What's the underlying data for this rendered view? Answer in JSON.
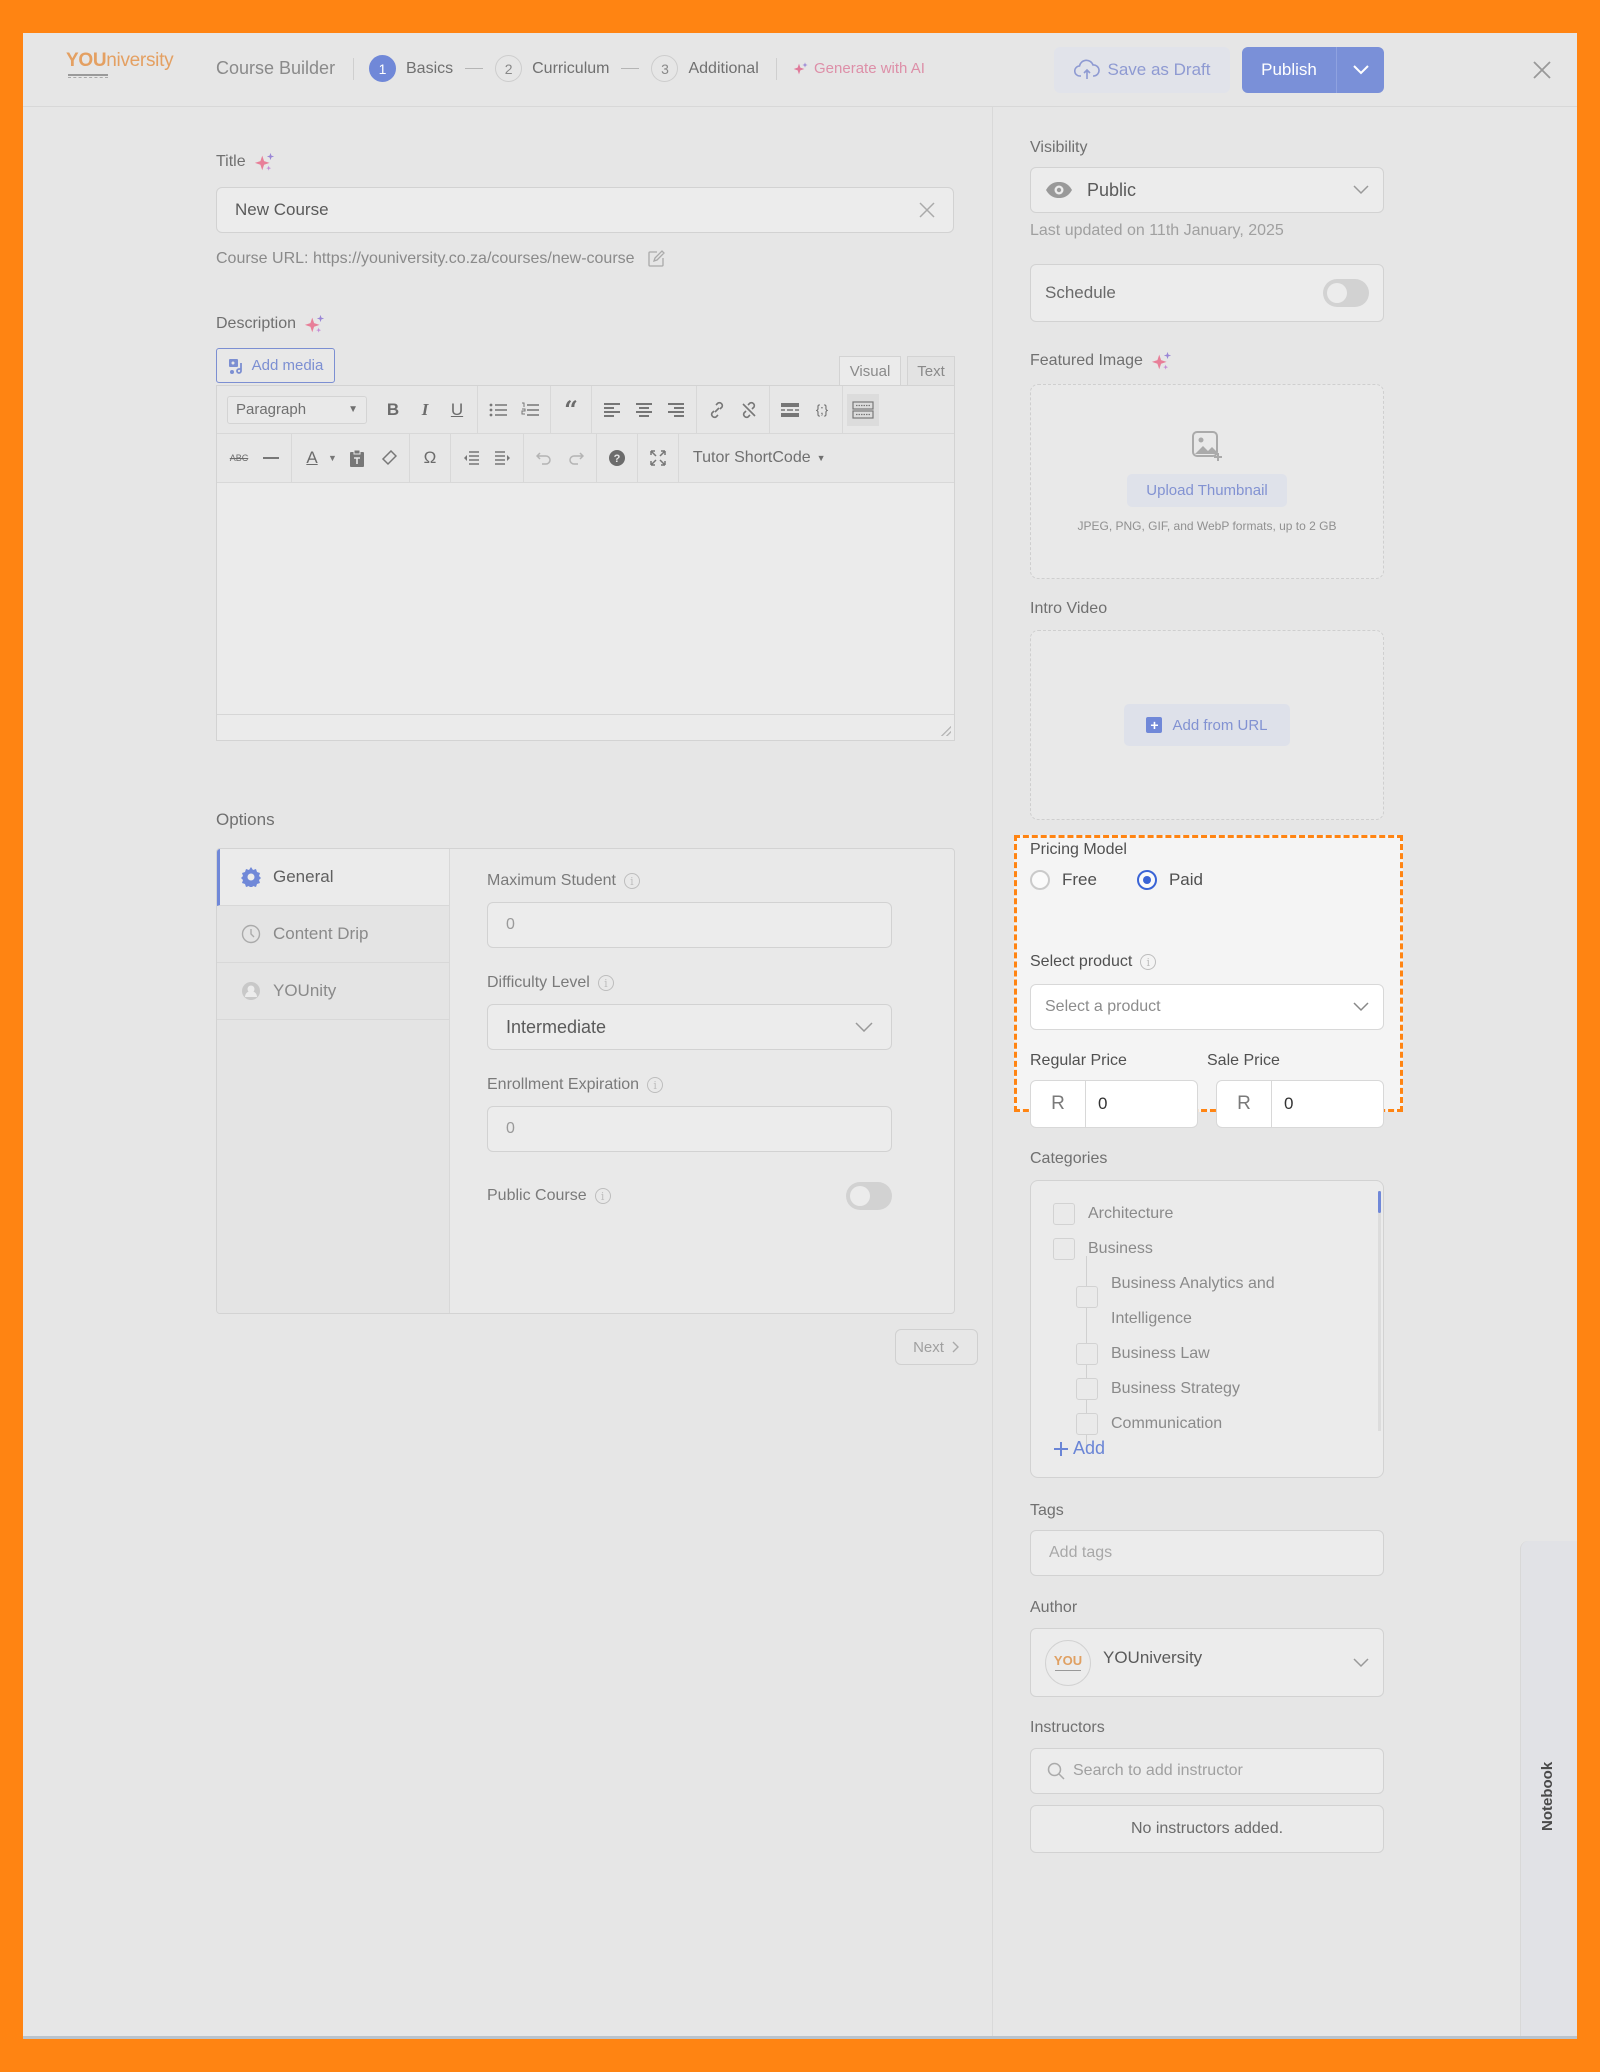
{
  "header": {
    "logo": {
      "bold": "YOU",
      "rest": "niversity"
    },
    "title": "Course Builder",
    "steps": [
      {
        "num": "1",
        "label": "Basics",
        "active": true
      },
      {
        "num": "2",
        "label": "Curriculum",
        "active": false
      },
      {
        "num": "3",
        "label": "Additional",
        "active": false
      }
    ],
    "generate_ai": "Generate with AI",
    "save_draft": "Save as Draft",
    "publish": "Publish"
  },
  "main": {
    "title_label": "Title",
    "title_value": "New Course",
    "course_url_label": "Course URL:",
    "course_url": "https://youniversity.co.za/courses/new-course",
    "description_label": "Description",
    "add_media": "Add media",
    "editor_tabs": {
      "visual": "Visual",
      "text": "Text",
      "active": "visual"
    },
    "paragraph_select": "Paragraph",
    "shortcode": "Tutor ShortCode",
    "options_label": "Options",
    "option_tabs": [
      {
        "label": "General",
        "icon": "gear-icon",
        "active": true
      },
      {
        "label": "Content Drip",
        "icon": "clock-icon",
        "active": false
      },
      {
        "label": "YOUnity",
        "icon": "community-icon",
        "active": false
      }
    ],
    "general": {
      "max_student_label": "Maximum Student",
      "max_student_value": "0",
      "difficulty_label": "Difficulty Level",
      "difficulty_value": "Intermediate",
      "enroll_exp_label": "Enrollment Expiration",
      "enroll_exp_value": "0",
      "public_course_label": "Public Course",
      "public_course_on": false
    },
    "next": "Next"
  },
  "sidebar": {
    "visibility_label": "Visibility",
    "visibility_value": "Public",
    "last_updated": "Last updated on 11th January, 2025",
    "schedule_label": "Schedule",
    "schedule_on": false,
    "featured_label": "Featured Image",
    "upload_thumbnail": "Upload Thumbnail",
    "formats": "JPEG, PNG, GIF, and WebP formats, up to 2 GB",
    "intro_video_label": "Intro Video",
    "add_from_url": "Add from URL",
    "pricing": {
      "label": "Pricing Model",
      "options": [
        "Free",
        "Paid"
      ],
      "selected": "Paid",
      "select_product_label": "Select product",
      "select_product_placeholder": "Select a product",
      "regular_price_label": "Regular Price",
      "sale_price_label": "Sale Price",
      "currency": "R",
      "regular_price": "0",
      "sale_price": "0"
    },
    "categories_label": "Categories",
    "categories": [
      {
        "label": "Architecture",
        "level": 0
      },
      {
        "label": "Business",
        "level": 0
      },
      {
        "label": "Business Analytics and Intelligence",
        "level": 1
      },
      {
        "label": "Business Law",
        "level": 1
      },
      {
        "label": "Business Strategy",
        "level": 1
      },
      {
        "label": "Communication",
        "level": 1
      }
    ],
    "add_category": "Add",
    "tags_label": "Tags",
    "tags_placeholder": "Add tags",
    "author_label": "Author",
    "author_avatar_text": "YOU",
    "author_name": "YOUniversity",
    "instructors_label": "Instructors",
    "instructors_placeholder": "Search to add instructor",
    "no_instructors": "No instructors added."
  },
  "notebook": "Notebook",
  "colors": {
    "accent": "#7088d8",
    "highlight": "#ff8412",
    "brand": "#e4a062",
    "radio": "#3a64d6"
  }
}
